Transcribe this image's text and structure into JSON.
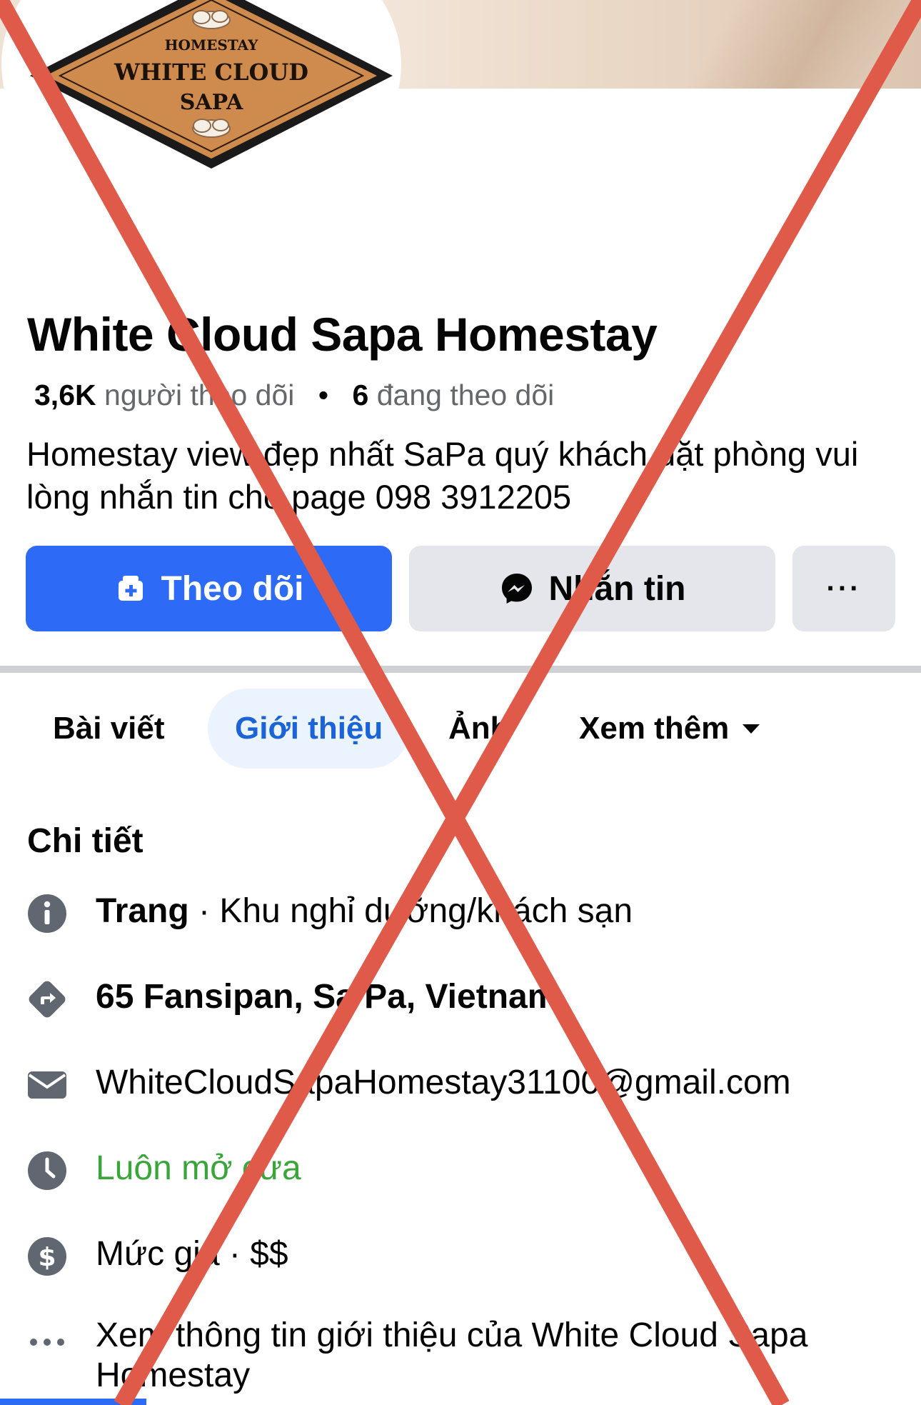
{
  "logo": {
    "line1": "HOMESTAY",
    "line2": "WHITE CLOUD",
    "line3": "SAPA"
  },
  "page": {
    "name": "White Cloud Sapa Homestay",
    "followers_count": "3,6K",
    "followers_label": "người theo dõi",
    "separator": "•",
    "following_count": "6",
    "following_label": "đang theo dõi",
    "description": "Homestay view đẹp nhất SaPa quý khách đặt phòng vui lòng nhắn tin cho page 098 3912205"
  },
  "buttons": {
    "follow": "Theo dõi",
    "message": "Nhắn tin",
    "more": "···"
  },
  "tabs": [
    {
      "label": "Bài viết",
      "active": false
    },
    {
      "label": "Giới thiệu",
      "active": true
    },
    {
      "label": "Ảnh",
      "active": false
    },
    {
      "label": "Xem thêm",
      "active": false
    }
  ],
  "details": {
    "title": "Chi tiết",
    "category_bold": "Trang",
    "category_rest": " · Khu nghỉ dưỡng/khách sạn",
    "address": "65 Fansipan, Sa Pa, Vietnam",
    "email": "WhiteCloudSapaHomestay31100@gmail.com",
    "hours": "Luôn mở cửa",
    "price": "Mức giá · $$",
    "see_more": "Xem thông tin giới thiệu của White Cloud Sapa Homestay"
  },
  "colors": {
    "facebook_blue": "#2d6af6",
    "button_gray": "#e4e6eb",
    "open_green": "#3aa53a",
    "x_mark_red": "#e05a4a",
    "logo_orange": "#cf8a4e"
  },
  "icons": [
    "info-icon",
    "directions-icon",
    "mail-icon",
    "clock-icon",
    "dollar-icon",
    "more-dots-icon",
    "messenger-icon",
    "follow-icon",
    "caret-down-icon"
  ]
}
